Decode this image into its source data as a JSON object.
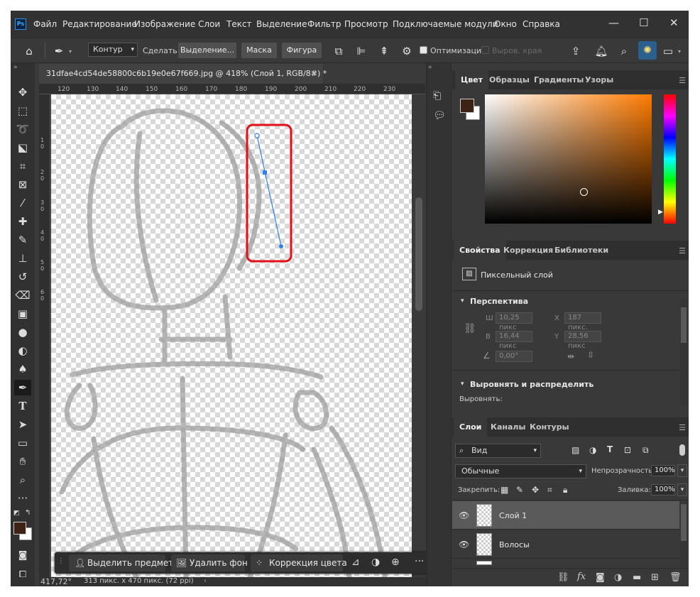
{
  "app": {
    "logo": "Ps",
    "menu": [
      "Файл",
      "Редактирование",
      "Изображение",
      "Слои",
      "Текст",
      "Выделение",
      "Фильтр",
      "Просмотр",
      "Подключаемые модули",
      "Окно",
      "Справка"
    ],
    "window_controls": [
      "minimize-icon",
      "maximize-icon",
      "close-icon"
    ]
  },
  "options": {
    "mode_value": "Контур",
    "make_label": "Сделать:",
    "selection_btn": "Выделение...",
    "mask_btn": "Маска",
    "shape_btn": "Фигура",
    "optimize_label": "Оптимизация",
    "optimize_checked": true,
    "align_edges_label": "Выров. края",
    "align_edges_checked": false
  },
  "document": {
    "tab_title": "31dfae4cd54de58800c6b19e0e67f669.jpg @ 418% (Слой 1, RGB/8#) *",
    "ruler_h": [
      "120",
      "130",
      "140",
      "150",
      "160",
      "170",
      "180",
      "190",
      "200",
      "210",
      "220",
      "230"
    ],
    "ruler_v": [
      "1 0",
      "2 0",
      "3 0",
      "4 0",
      "5 0",
      "6 0"
    ],
    "zoom": "417,72°",
    "doc_info": "313 пикс. x 470 пикс. (72 ppi)"
  },
  "contextbar": {
    "select_subject": "Выделить предмет",
    "remove_bg": "Удалить фон",
    "color_correction": "Коррекция цвета"
  },
  "color_panel": {
    "tabs": [
      "Цвет",
      "Образцы",
      "Градиенты",
      "Узоры"
    ],
    "foreground": "#3d2216",
    "background": "#ffffff",
    "hue_base": "#ff7a00"
  },
  "properties": {
    "tabs": [
      "Свойства",
      "Коррекция",
      "Библиотеки"
    ],
    "layer_type": "Пиксельный слой",
    "perspective_title": "Перспектива",
    "w_label": "Ш",
    "w_value": "10,25 пикс",
    "x_label": "X",
    "x_value": "187 пикс.",
    "h_label": "В",
    "h_value": "16,44 пикс",
    "y_label": "Y",
    "y_value": "28,56 пикс",
    "angle_value": "0,00°",
    "align_title": "Выровнять и распределить",
    "align_label": "Выровнять:"
  },
  "layers": {
    "tabs": [
      "Слои",
      "Каналы",
      "Контуры"
    ],
    "filter_value": "Вид",
    "blend_mode": "Обычные",
    "opacity_label": "Непрозрачность:",
    "opacity_value": "100%",
    "lock_label": "Закрепить:",
    "fill_label": "Заливка:",
    "fill_value": "100%",
    "items": [
      {
        "name": "Слой 1",
        "selected": true
      },
      {
        "name": "Волосы",
        "selected": false
      }
    ]
  }
}
